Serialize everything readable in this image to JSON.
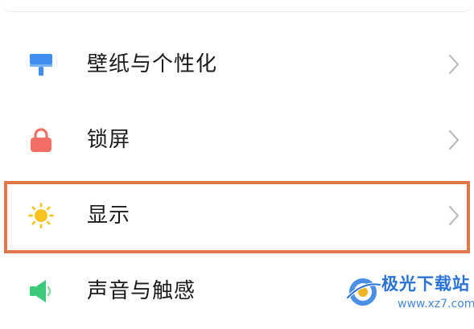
{
  "settings": {
    "items": [
      {
        "label": "壁纸与个性化",
        "icon": "wallpaper-brush-icon",
        "icon_color": "#3f8ef0"
      },
      {
        "label": "锁屏",
        "icon": "lock-icon",
        "icon_color": "#f36f66"
      },
      {
        "label": "显示",
        "icon": "sun-icon",
        "icon_color": "#f8c21f",
        "highlighted": true
      },
      {
        "label": "声音与触感",
        "icon": "speaker-icon",
        "icon_color": "#3dc97a"
      }
    ]
  },
  "colors": {
    "highlight_border": "#e07646",
    "chevron": "#bdbdbd",
    "text": "#1b1b1b",
    "watermark": "#2a72d8"
  },
  "watermark": {
    "title": "极光下载站",
    "url": "www.xz7.com"
  }
}
